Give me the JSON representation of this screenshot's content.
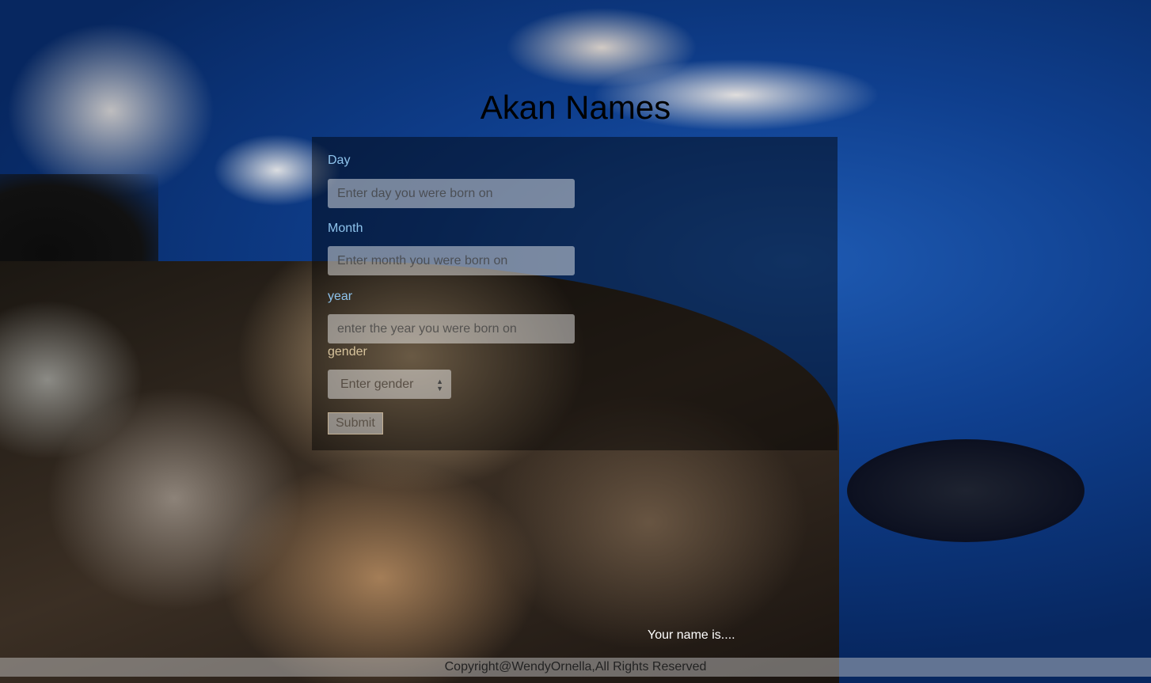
{
  "page": {
    "title": "Akan Names"
  },
  "form": {
    "day": {
      "label": "Day",
      "placeholder": "Enter day you were born on"
    },
    "month": {
      "label": "Month",
      "placeholder": "Enter month you were born on"
    },
    "year": {
      "label": "year",
      "placeholder": "enter the year you were born on"
    },
    "gender": {
      "label": "gender",
      "selected": "Enter gender",
      "arrows_icon": "select-arrows-icon"
    },
    "submit_label": "Submit"
  },
  "result": {
    "text": "Your name is...."
  },
  "footer": {
    "copyright": "Copyright@WendyOrnella,All Rights Reserved"
  },
  "colors": {
    "label_blue": "#8ec3ec",
    "label_warm": "#d7c39c",
    "panel_overlay": "rgba(0,0,0,0.45)",
    "result_text": "#ffffff"
  }
}
